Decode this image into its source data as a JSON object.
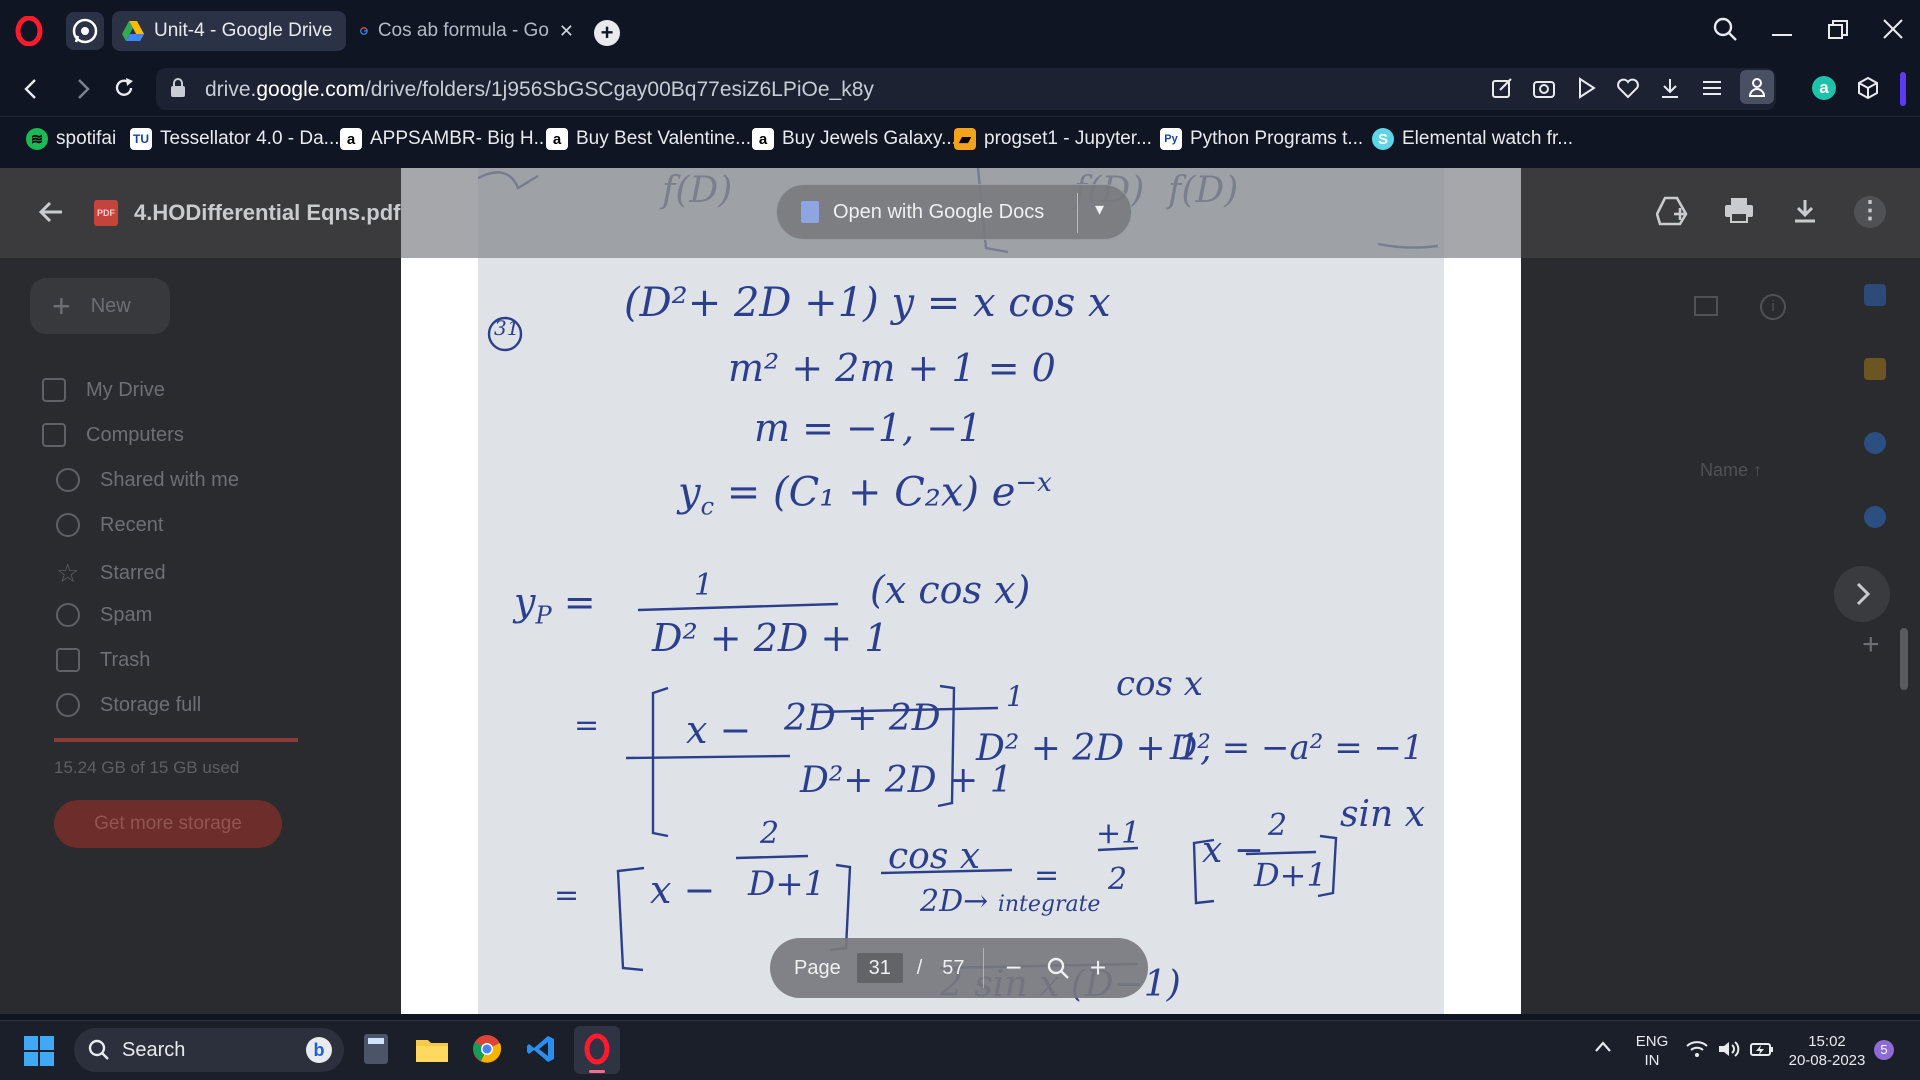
{
  "browser": {
    "tabs": [
      {
        "title": "Unit-4 - Google Drive",
        "active": true,
        "icon": "google-drive-icon"
      },
      {
        "title": "Cos ab formula - Go",
        "active": false,
        "icon": "google-icon"
      }
    ],
    "url_prefix": "drive.",
    "url_domain": "google.com",
    "url_path": "/drive/folders/1j956SbGSCgay00Bq77esiZ6LPiOe_k8y",
    "bookmarks": [
      {
        "label": "spotifai",
        "icon": "spotify-icon"
      },
      {
        "label": "Tessellator 4.0 - Da...",
        "icon": "tessellator-icon"
      },
      {
        "label": "APPSAMBR- Big H...",
        "icon": "amazon-icon"
      },
      {
        "label": "Buy Best Valentine...",
        "icon": "amazon-icon"
      },
      {
        "label": "Buy Jewels Galaxy...",
        "icon": "amazon-icon"
      },
      {
        "label": "progset1 - Jupyter...",
        "icon": "jupyter-icon"
      },
      {
        "label": "Python Programs t...",
        "icon": "python-icon"
      },
      {
        "label": "Elemental watch fr...",
        "icon": "elemental-icon"
      }
    ]
  },
  "drive": {
    "file_name": "4.HODifferential Eqns.pdf",
    "file_badge": "PDF",
    "new_label": "New",
    "sidebar": [
      {
        "label": "My Drive"
      },
      {
        "label": "Computers"
      },
      {
        "label": "Shared with me"
      },
      {
        "label": "Recent"
      },
      {
        "label": "Starred"
      },
      {
        "label": "Spam"
      },
      {
        "label": "Trash"
      },
      {
        "label": "Storage full"
      }
    ],
    "storage_text": "15.24 GB of 15 GB used",
    "storage_fraction": 1.0,
    "get_storage_label": "Get more storage",
    "sort_label": "Name"
  },
  "viewer": {
    "open_with_label": "Open with Google Docs",
    "page_label": "Page",
    "current_page": "31",
    "separator": "/",
    "total_pages": "57"
  },
  "taskbar": {
    "search_label": "Search",
    "lang_top": "ENG",
    "lang_bottom": "IN",
    "time": "15:02",
    "date": "20-08-2023",
    "notification_count": "5"
  }
}
